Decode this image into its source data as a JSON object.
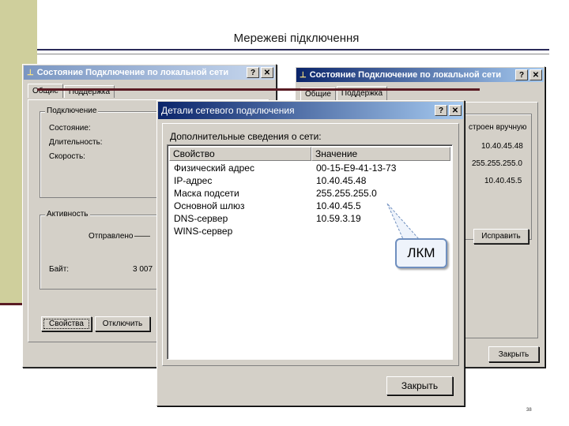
{
  "slide": {
    "title": "Мережеві підключення",
    "page_number": "38"
  },
  "win_left": {
    "title": "Состояние Подключение по локальной сети",
    "help_label": "?",
    "close_label": "✕",
    "tabs": [
      "Общие",
      "Поддержка"
    ],
    "group_connection": "Подключение",
    "status_label": "Состояние:",
    "duration_label": "Длительность:",
    "speed_label": "Скорость:",
    "group_activity": "Активность",
    "sent_label": "Отправлено",
    "sent_dash": "——",
    "bytes_label": "Байт:",
    "bytes_value": "3 007",
    "properties_button": "Свойства",
    "disable_button": "Отключить"
  },
  "win_right": {
    "title": "Состояние Подключение по локальной сети",
    "help_label": "?",
    "close_label": "✕",
    "tabs": [
      "Общие",
      "Поддержка"
    ],
    "manual_label": "строен вручную",
    "values": [
      "10.40.45.48",
      "255.255.255.0",
      "10.40.45.5"
    ],
    "repair_button": "Исправить",
    "close_button": "Закрыть"
  },
  "win_details": {
    "title": "Детали сетевого подключения",
    "help_label": "?",
    "close_label": "✕",
    "heading": "Дополнительные сведения о сети:",
    "col_property": "Свойство",
    "col_value": "Значение",
    "rows": [
      {
        "prop": "Физический адрес",
        "val": "00-15-E9-41-13-73"
      },
      {
        "prop": "IP-адрес",
        "val": "10.40.45.48"
      },
      {
        "prop": "Маска подсети",
        "val": "255.255.255.0"
      },
      {
        "prop": "Основной шлюз",
        "val": "10.40.45.5"
      },
      {
        "prop": "DNS-сервер",
        "val": "10.59.3.19"
      },
      {
        "prop": "WINS-сервер",
        "val": ""
      }
    ],
    "close_button": "Закрыть"
  },
  "callout": {
    "text": "ЛКМ"
  },
  "colors": {
    "titlebar_active": "#0a246a",
    "titlebar_gradient_end": "#a6caf0",
    "dialog_face": "#d4d0c8",
    "left_band": "#cfcf9c"
  }
}
